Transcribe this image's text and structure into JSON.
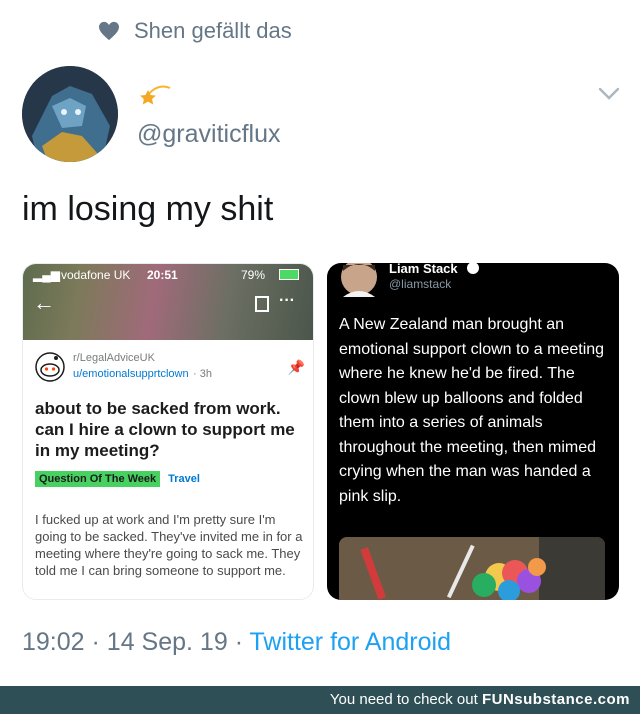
{
  "liked_by": {
    "text": "Shen gefällt das"
  },
  "author": {
    "handle": "@graviticflux"
  },
  "tweet": {
    "text": "im losing my shit"
  },
  "left_image": {
    "carrier": "vodafone UK",
    "time": "20:51",
    "battery": "79%",
    "subreddit": "r/LegalAdviceUK",
    "user": "u/emotionalsupprtclown",
    "age": "· 3h",
    "title": "about to be sacked from work. can I hire a clown to support me in my meeting?",
    "flair_1": "Question Of The Week",
    "flair_2": "Travel",
    "body": "I fucked up at work and I'm pretty sure I'm going to be sacked. They've invited me in for a meeting where they're going to sack me. They told me I can bring someone to support me."
  },
  "right_image": {
    "name": "Liam Stack",
    "handle": "@liamstack",
    "text": "A New Zealand man brought an emotional support clown to a meeting where he knew he'd be fired. The clown blew up balloons and folded them into a series of animals throughout the meeting, then mimed crying when the man was handed a pink slip."
  },
  "meta": {
    "time": "19:02",
    "sep1": "·",
    "date": "14 Sep. 19",
    "sep2": "·",
    "source": "Twitter for Android"
  },
  "footer": {
    "prefix": "You need to check out",
    "brand": "FUNsubstance.com"
  },
  "colors": {
    "link": "#1da1f2",
    "muted": "#657786",
    "footer_bg": "#2e4f55",
    "flair_green": "#46d160"
  }
}
